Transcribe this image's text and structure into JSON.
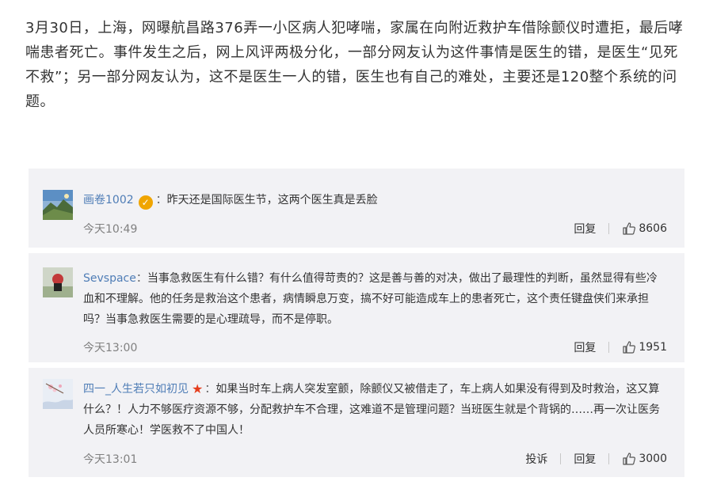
{
  "article": {
    "text": "3月30日，上海，网曝航昌路376弄一小区病人犯哮喘，家属在向附近救护车借除颤仪时遭拒，最后哮喘患者死亡。事件发生之后，网上风评两极分化，一部分网友认为这件事情是医生的错，是医生“见死不救”；另一部分网友认为，这不是医生一人的错，医生也有自己的难处，主要还是120整个系统的问题。"
  },
  "comments": [
    {
      "user": "画卷1002",
      "badge": "verified",
      "text": "昨天还是国际医生节，这两个医生真是丢脸",
      "time": "今天10:49",
      "reply_label": "回复",
      "likes": "8606"
    },
    {
      "user": "Sevspace",
      "text": "当事急救医生有什么错？有什么值得苛责的？这是善与善的对决，做出了最理性的判断，虽然显得有些冷血和不理解。他的任务是救治这个患者，病情瞬息万变，搞不好可能造成车上的患者死亡，这个责任键盘侠们来承担吗？当事急救医生需要的是心理疏导，而不是停职。",
      "time": "今天13:00",
      "reply_label": "回复",
      "likes": "1951"
    },
    {
      "user": "四一_人生若只如初见",
      "badge": "star",
      "text": "如果当时车上病人突发室颤，除颤仪又被借走了，车上病人如果没有得到及时救治，这又算什么？！人力不够医疗资源不够，分配救护车不合理，这难道不是管理问题？当班医生就是个背锅的……再一次让医务人员所寒心！学医救不了中国人！",
      "time": "今天13:01",
      "report_label": "投诉",
      "reply_label": "回复",
      "likes": "3000"
    }
  ],
  "colors": {
    "username": "#4f7db6",
    "comment_bg": "#f2f2f5",
    "badge": "#f0a500",
    "star": "#e53d1c"
  },
  "icons": {
    "like": "thumbs-up-icon",
    "verified": "verified-badge-icon",
    "star": "star-icon"
  }
}
